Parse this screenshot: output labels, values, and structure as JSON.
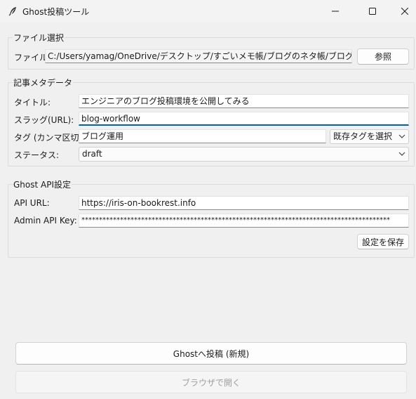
{
  "window": {
    "title": "Ghost投稿ツール"
  },
  "file_section": {
    "label": "ファイル選択",
    "file_label": "ファイル:",
    "file_path": "C:/Users/yamag/OneDrive/デスクトップ/すごいメモ帳/ブログのネタ帳/ブログ運用/エンジニア",
    "browse_label": "参照"
  },
  "meta_section": {
    "label": "記事メタデータ",
    "title_label": "タイトル:",
    "title_value": "エンジニアのブログ投稿環境を公開してみる",
    "slug_label": "スラッグ(URL):",
    "slug_value": "blog-workflow",
    "tags_label": "タグ (カンマ区切り):",
    "tags_value": "ブログ運用",
    "tag_select": "既存タグを選択",
    "status_label": "ステータス:",
    "status_value": "draft"
  },
  "api_section": {
    "label": "Ghost API設定",
    "url_label": "API URL:",
    "url_value": "https://iris-on-bookrest.info",
    "key_label": "Admin API Key:",
    "key_value": "****************************************************************************************",
    "save_label": "設定を保存"
  },
  "actions": {
    "post_label": "Ghostへ投稿 (新規)",
    "open_label": "ブラウザで開く"
  },
  "colors": {
    "accent": "#005fb8",
    "background": "#f0f0f0"
  }
}
